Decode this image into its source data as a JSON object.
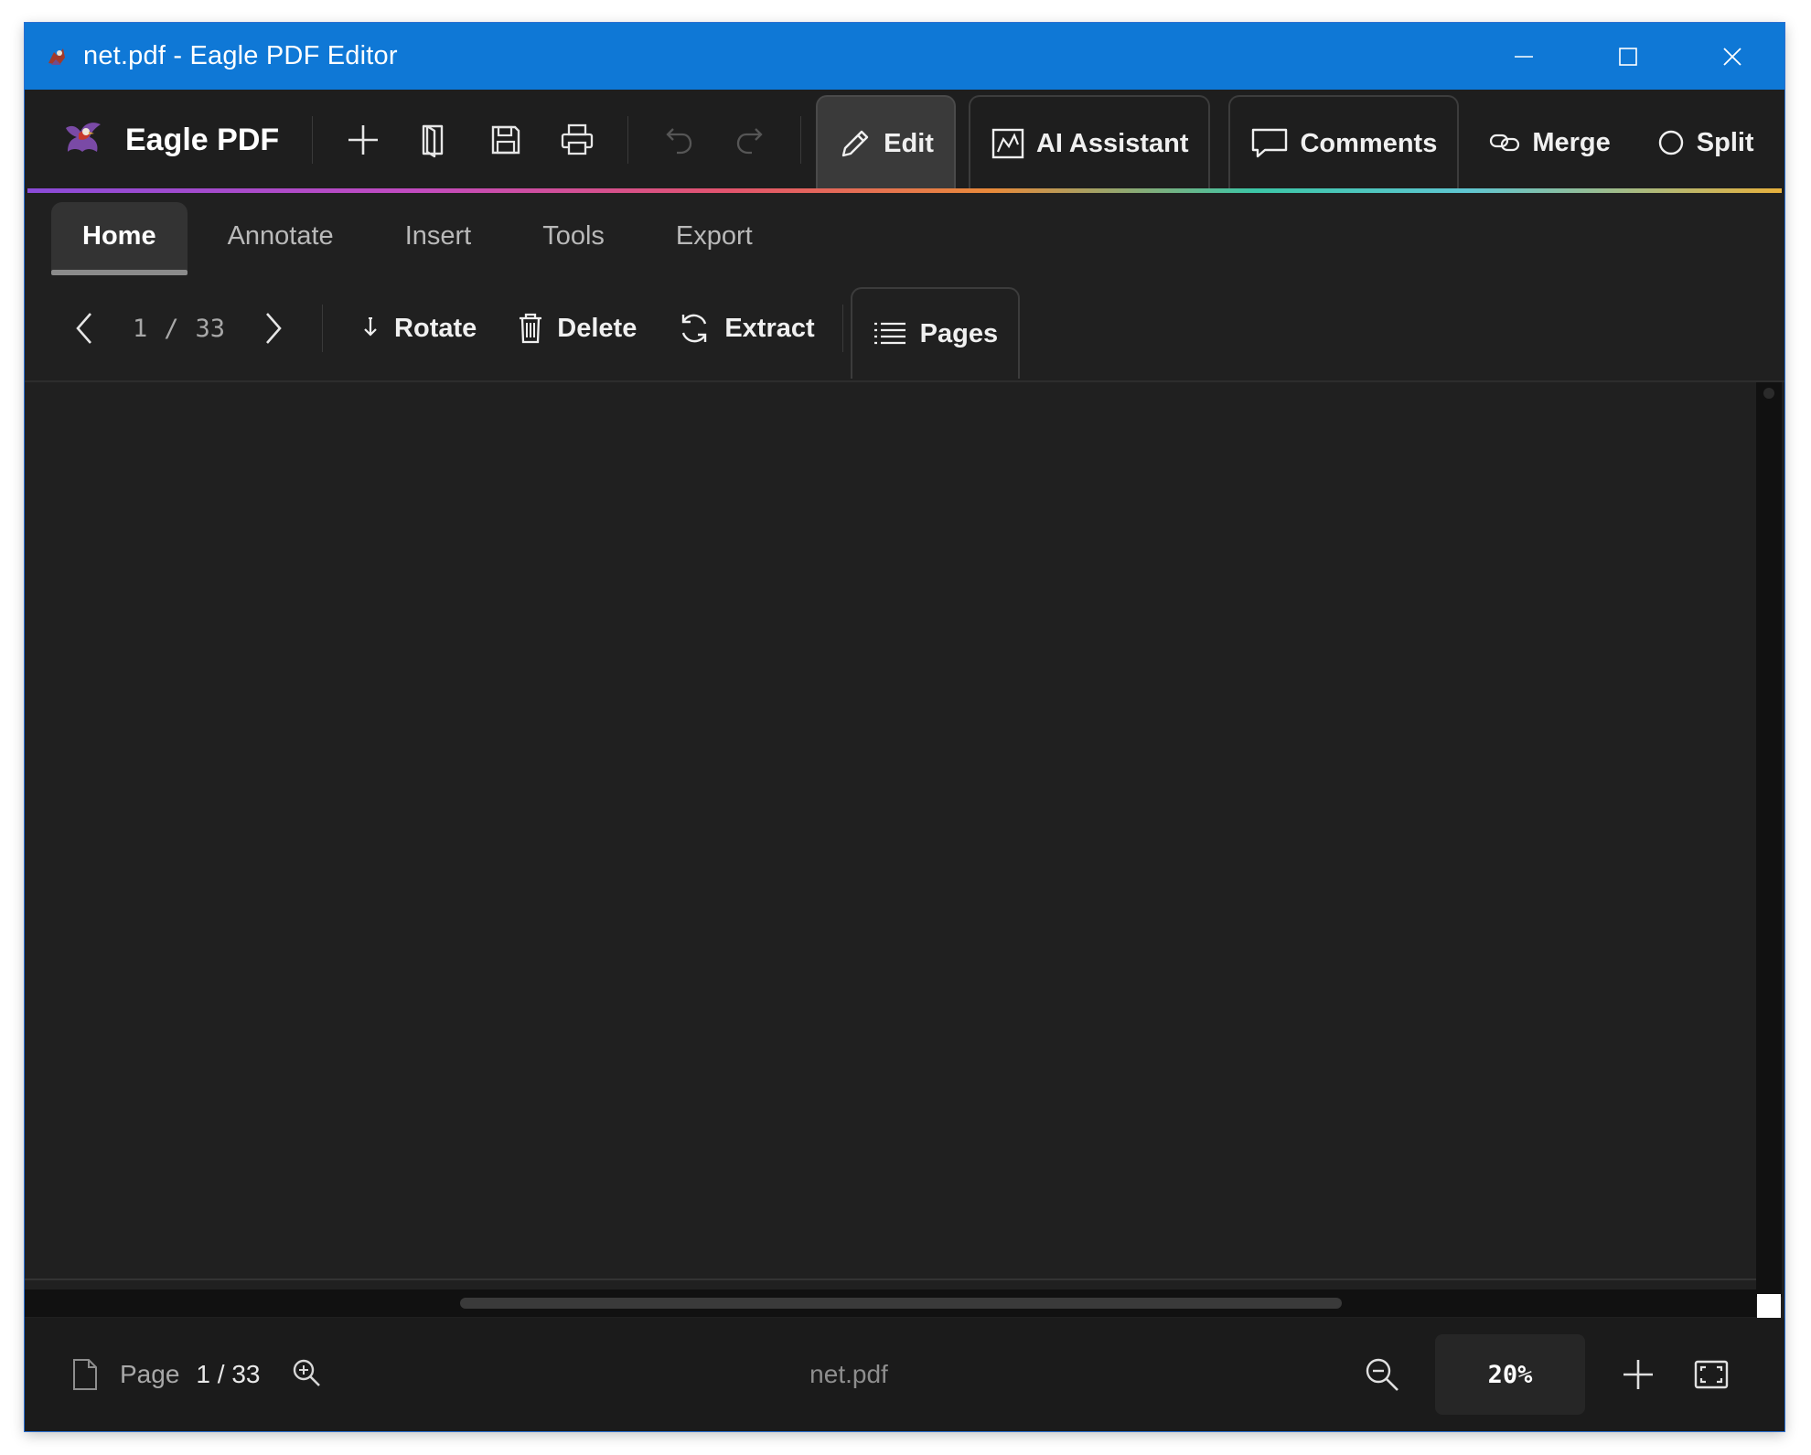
{
  "titlebar": {
    "title": "net.pdf - Eagle PDF Editor",
    "controls": [
      "minimize-icon",
      "maximize-icon",
      "close-icon"
    ]
  },
  "toolbar": {
    "brand": "Eagle PDF",
    "icons": [
      "plus-icon",
      "open-document-icon",
      "save-icon",
      "print-icon",
      "undo-icon",
      "redo-icon"
    ],
    "modes": [
      {
        "label": "Edit",
        "icon": "pencil-icon",
        "active": true
      },
      {
        "label": "AI Assistant",
        "icon": "chart-icon"
      },
      {
        "label": "Comments",
        "icon": "comment-icon"
      },
      {
        "label": "Merge",
        "icon": "link-icon"
      },
      {
        "label": "Split",
        "icon": "circle-icon"
      }
    ]
  },
  "ribbon": {
    "tabs": [
      "Home",
      "Annotate",
      "Insert",
      "Tools",
      "Export"
    ],
    "active_tab": "Home"
  },
  "subtoolbar": {
    "current_page": "1",
    "separator": "/",
    "total_pages": "33",
    "buttons": [
      {
        "label": "Rotate",
        "icon": "rotate-arrow-icon"
      },
      {
        "label": "Delete",
        "icon": "trash-icon"
      },
      {
        "label": "Extract",
        "icon": "refresh-icon"
      },
      {
        "label": "Pages",
        "icon": "list-icon"
      }
    ]
  },
  "statusbar": {
    "page_label": "Page",
    "page_value": "1 / 33",
    "filename": "net.pdf",
    "zoom": "20%"
  },
  "colors": {
    "titlebar": "#0f78d6",
    "background": "#202020",
    "text": "#f0f0f0"
  }
}
